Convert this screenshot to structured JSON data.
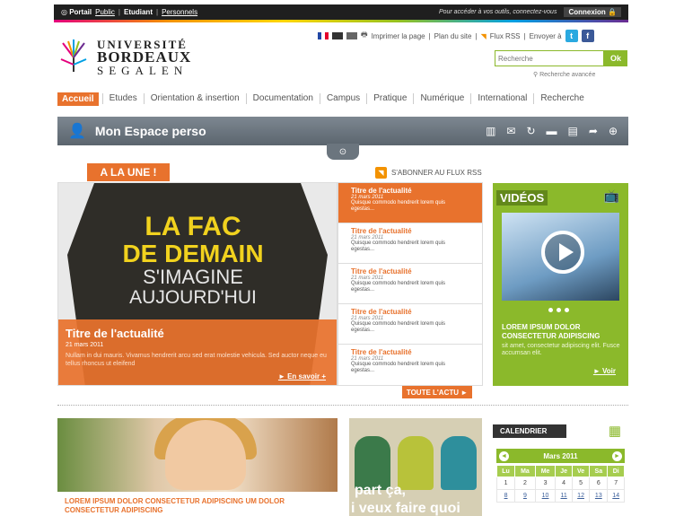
{
  "topbar": {
    "portal": "Portail",
    "links": [
      "Public",
      "Etudiant",
      "Personnels"
    ],
    "message": "Pour accéder à vos outils, connectez-vous",
    "login": "Connexion"
  },
  "logo": {
    "line1": "UNIVERSITÉ",
    "line2": "BORDEAUX",
    "line3": "SEGALEN"
  },
  "utility": {
    "print": "Imprimer la page",
    "plan": "Plan du site",
    "flux": "Flux RSS",
    "share": "Envoyer à"
  },
  "search": {
    "placeholder": "Recherche",
    "ok": "Ok",
    "advanced": "Recherche avancée"
  },
  "nav": [
    "Accueil",
    "Etudes",
    "Orientation & insertion",
    "Documentation",
    "Campus",
    "Pratique",
    "Numérique",
    "International",
    "Recherche"
  ],
  "espace": {
    "title": "Mon Espace perso"
  },
  "alaune": "A LA UNE !",
  "rss": "S'ABONNER AU FLUX RSS",
  "hero": {
    "shirt1": "LA FAC",
    "shirt2": "DE DEMAIN",
    "shirt3": "S'IMAGINE",
    "shirt4": "AUJOURD'HUI",
    "title": "Titre de l'actualité",
    "date": "21 mars 2011",
    "text": "Nullam in dui mauris. Vivamus hendrerit arcu sed erat molestie vehicula. Sed auctor neque eu tellus rhoncus ut eleifend",
    "more": "En savoir +"
  },
  "news": [
    {
      "title": "Titre de l'actualité",
      "date": "21 mars 2011",
      "text": "Quisque commodo hendrerit lorem quis egestas..."
    },
    {
      "title": "Titre de l'actualité",
      "date": "21 mars 2011",
      "text": "Quisque commodo hendrerit lorem quis egestas..."
    },
    {
      "title": "Titre de l'actualité",
      "date": "21 mars 2011",
      "text": "Quisque commodo hendrerit lorem quis egestas..."
    },
    {
      "title": "Titre de l'actualité",
      "date": "21 mars 2011",
      "text": "Quisque commodo hendrerit lorem quis egestas..."
    },
    {
      "title": "Titre de l'actualité",
      "date": "21 mars 2011",
      "text": "Quisque commodo hendrerit lorem quis egestas..."
    }
  ],
  "toute": "TOUTE L'ACTU",
  "videos": {
    "title": "VIDÉOS",
    "vtitle": "LOREM IPSUM DOLOR CONSECTETUR ADIPISCING",
    "vtext": "sit amet, consectetur adipiscing elit. Fusce accumsan elit.",
    "more": "Voir"
  },
  "promo1": {
    "text": "LOREM IPSUM DOLOR CONSECTETUR ADIPISCING UM DOLOR CONSECTETUR ADIPISCING"
  },
  "promo2": {
    "line1": "part ça,",
    "line2": "i veux faire quoi"
  },
  "calendar": {
    "title": "CALENDRIER",
    "month": "Mars 2011",
    "days": [
      "Lu",
      "Ma",
      "Me",
      "Je",
      "Ve",
      "Sa",
      "Di"
    ],
    "rows": [
      [
        "1",
        "2",
        "3",
        "4",
        "5",
        "6",
        "7"
      ],
      [
        "8",
        "9",
        "10",
        "11",
        "12",
        "13",
        "14"
      ]
    ]
  }
}
